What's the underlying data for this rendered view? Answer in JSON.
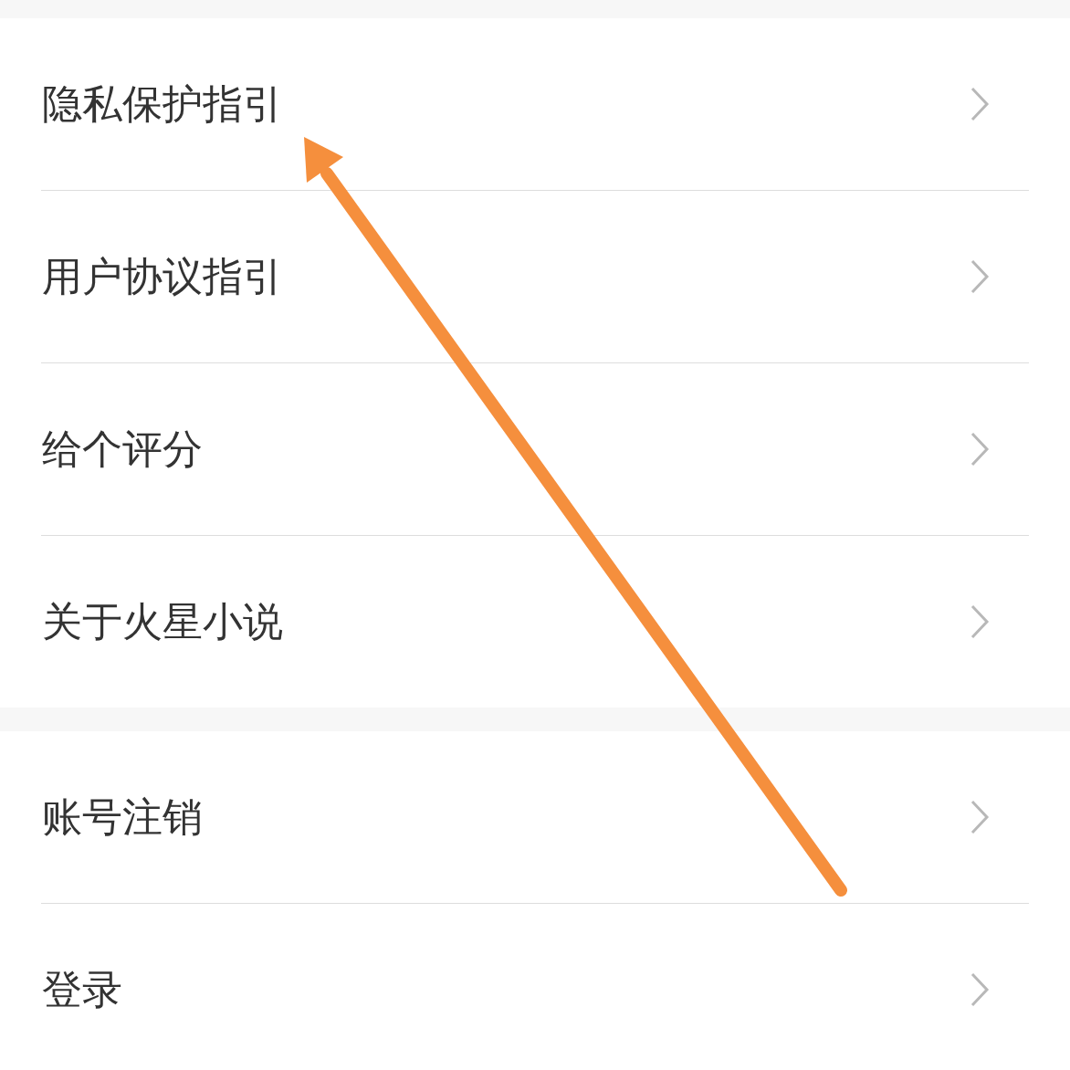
{
  "groups": [
    {
      "items": [
        {
          "label": "隐私保护指引"
        },
        {
          "label": "用户协议指引"
        },
        {
          "label": "给个评分"
        },
        {
          "label": "关于火星小说"
        }
      ]
    },
    {
      "items": [
        {
          "label": "账号注销"
        },
        {
          "label": "登录"
        }
      ]
    }
  ]
}
